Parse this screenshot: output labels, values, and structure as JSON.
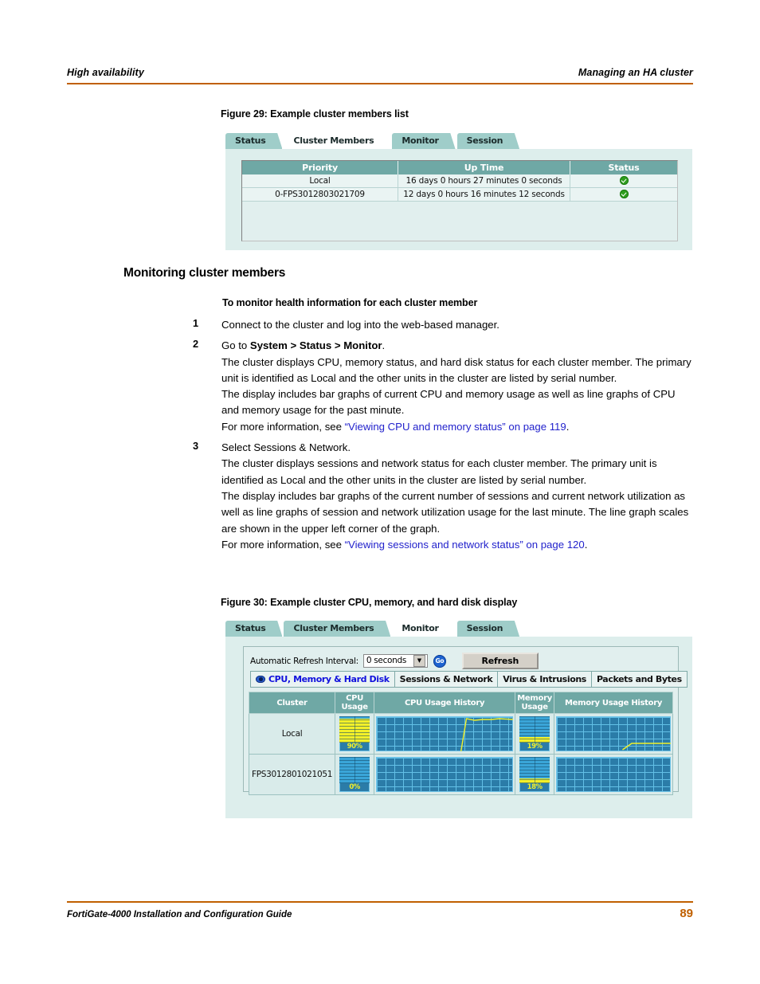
{
  "header": {
    "left": "High availability",
    "right": "Managing an HA cluster",
    "rule_color": "#c06000"
  },
  "figure29": {
    "caption": "Figure 29: Example cluster members list",
    "tabs": [
      {
        "label": "Status",
        "active": false
      },
      {
        "label": "Cluster Members",
        "active": true
      },
      {
        "label": "Monitor",
        "active": false
      },
      {
        "label": "Session",
        "active": false
      }
    ],
    "table": {
      "columns": [
        "Priority",
        "Up Time",
        "Status"
      ],
      "rows": [
        {
          "priority": "Local",
          "uptime": "16 days 0 hours 27 minutes 0 seconds",
          "status": "ok"
        },
        {
          "priority": "0-FPS3012803021709",
          "uptime": "12 days 0 hours 16 minutes 12 seconds",
          "status": "ok"
        }
      ]
    }
  },
  "section": {
    "heading": "Monitoring cluster members",
    "subheading": "To monitor health information for each cluster member",
    "steps": [
      {
        "num": "1",
        "paras": [
          {
            "text": "Connect to the cluster and log into the web-based manager."
          }
        ]
      },
      {
        "num": "2",
        "paras": [
          {
            "pre": "Go to ",
            "bold": "System > Status > Monitor",
            "post": "."
          },
          {
            "text": "The cluster displays CPU, memory status, and hard disk status for each cluster member. The primary unit is identified as Local and the other units in the cluster are listed by serial number."
          },
          {
            "text": "The display includes bar graphs of current CPU and memory usage as well as line graphs of CPU and memory usage for the past minute."
          },
          {
            "pre": "For more information, see ",
            "link": "“Viewing CPU and memory status” on page 119",
            "post": "."
          }
        ]
      },
      {
        "num": "3",
        "paras": [
          {
            "text": "Select Sessions & Network."
          },
          {
            "text": "The cluster displays sessions and network status for each cluster member. The primary unit is identified as Local and the other units in the cluster are listed by serial number."
          },
          {
            "text": "The display includes bar graphs of the current number of sessions and current network utilization as well as line graphs of session and network utilization usage for the last minute. The line graph scales are shown in the upper left corner of the graph."
          },
          {
            "pre": "For more information, see ",
            "link": "“Viewing sessions and network status” on page 120",
            "post": "."
          }
        ]
      }
    ],
    "link_color": "#2222cc"
  },
  "figure30": {
    "caption": "Figure 30: Example cluster CPU, memory, and hard disk display",
    "tabs": [
      {
        "label": "Status",
        "active": false
      },
      {
        "label": "Cluster Members",
        "active": false
      },
      {
        "label": "Monitor",
        "active": true
      },
      {
        "label": "Session",
        "active": false
      }
    ],
    "toolbar": {
      "refresh_label": "Automatic Refresh Interval:",
      "interval_value": "0 seconds",
      "go_label": "Go",
      "refresh_button": "Refresh"
    },
    "subtabs": [
      {
        "label": "CPU, Memory & Hard Disk",
        "active": true,
        "icon": "eye-icon"
      },
      {
        "label": "Sessions & Network",
        "active": false
      },
      {
        "label": "Virus & Intrusions",
        "active": false
      },
      {
        "label": "Packets and Bytes",
        "active": false
      }
    ],
    "chart_data": {
      "type": "table",
      "title": "Example cluster CPU, memory, and hard disk display",
      "columns": [
        "Cluster",
        "CPU Usage",
        "CPU Usage History",
        "Memory Usage",
        "Memory Usage History"
      ],
      "rows": [
        {
          "cluster": "Local",
          "cpu_usage": 90,
          "cpu_usage_label": "90%",
          "cpu_history": {
            "type": "line",
            "ylim": [
              0,
              100
            ],
            "x": [
              0,
              62,
              66,
              72,
              78,
              84,
              90,
              100
            ],
            "y": [
              0,
              0,
              95,
              92,
              93,
              93,
              95,
              93
            ]
          },
          "memory_usage": 19,
          "memory_usage_label": "19%",
          "memory_history": {
            "type": "line",
            "ylim": [
              0,
              100
            ],
            "x": [
              0,
              58,
              66,
              100
            ],
            "y": [
              0,
              0,
              20,
              20
            ]
          }
        },
        {
          "cluster": "FPS3012801021051",
          "cpu_usage": 0,
          "cpu_usage_label": "0%",
          "cpu_history": {
            "type": "line",
            "ylim": [
              0,
              100
            ],
            "x": [
              0,
              100
            ],
            "y": [
              0,
              0
            ]
          },
          "memory_usage": 18,
          "memory_usage_label": "18%",
          "memory_history": {
            "type": "line",
            "ylim": [
              0,
              100
            ],
            "x": [
              0,
              100
            ],
            "y": [
              0,
              0
            ]
          }
        }
      ],
      "bar_color": "#f2f029",
      "plot_bg": "#2b7ca8",
      "grid_color": "#63c0e6"
    }
  },
  "footer": {
    "title": "FortiGate-4000 Installation and Configuration Guide",
    "page": "89",
    "accent": "#c06000"
  }
}
